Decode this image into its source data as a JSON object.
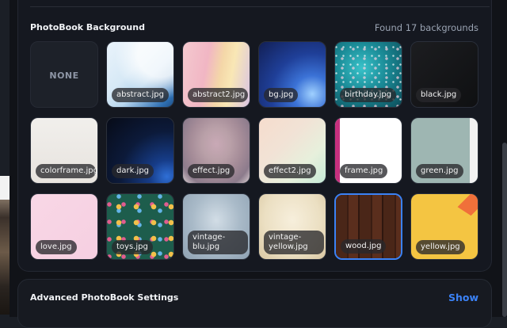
{
  "section": {
    "title": "PhotoBook Background",
    "found_text": "Found 17 backgrounds"
  },
  "none_label": "NONE",
  "backgrounds": [
    {
      "label": "abstract.jpg"
    },
    {
      "label": "abstract2.jpg"
    },
    {
      "label": "bg.jpg"
    },
    {
      "label": "birthday.jpg"
    },
    {
      "label": "black.jpg"
    },
    {
      "label": "colorframe.jpg"
    },
    {
      "label": "dark.jpg"
    },
    {
      "label": "effect.jpg"
    },
    {
      "label": "effect2.jpg"
    },
    {
      "label": "frame.jpg"
    },
    {
      "label": "green.jpg"
    },
    {
      "label": "love.jpg"
    },
    {
      "label": "toys.jpg"
    },
    {
      "label": "vintage-blu.jpg"
    },
    {
      "label": "vintage-yellow.jpg"
    },
    {
      "label": "wood.jpg"
    },
    {
      "label": "yellow.jpg"
    }
  ],
  "selected": "wood.jpg",
  "advanced": {
    "title": "Advanced PhotoBook Settings",
    "show_label": "Show"
  },
  "colors": {
    "accent": "#3b82f6",
    "panel": "#151820"
  }
}
